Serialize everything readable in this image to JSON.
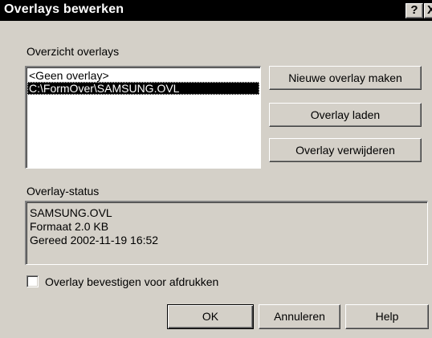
{
  "window": {
    "title": "Overlays bewerken",
    "help_glyph": "?",
    "close_glyph": "X"
  },
  "overview": {
    "label": "Overzicht overlays",
    "items": [
      {
        "label": "<Geen overlay>",
        "selected": false
      },
      {
        "label": "C:\\FormOver\\SAMSUNG.OVL",
        "selected": true
      }
    ]
  },
  "actions": {
    "new_label": "Nieuwe overlay maken",
    "load_label": "Overlay laden",
    "delete_label": "Overlay verwijderen"
  },
  "status": {
    "label": "Overlay-status",
    "lines": [
      "SAMSUNG.OVL",
      "Formaat 2.0 KB",
      "Gereed 2002-11-19 16:52"
    ]
  },
  "confirm": {
    "label": "Overlay bevestigen voor afdrukken",
    "checked": false
  },
  "footer": {
    "ok_label": "OK",
    "cancel_label": "Annuleren",
    "help_label": "Help"
  }
}
